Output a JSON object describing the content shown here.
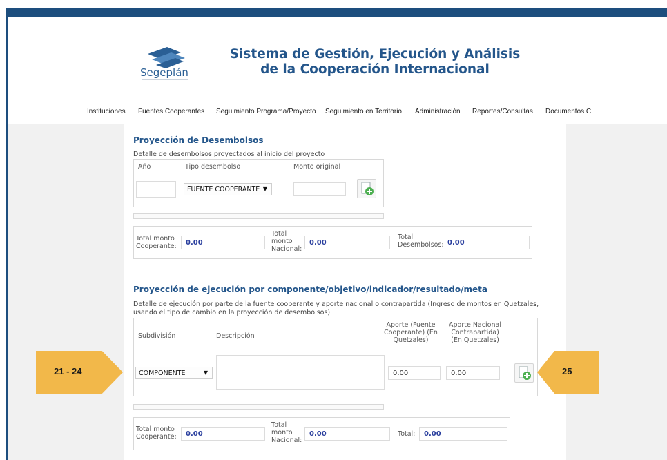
{
  "logo": {
    "text": "Segeplán",
    "icon": "segeplan-logo-icon"
  },
  "title": {
    "line1": "Sistema de Gestión, Ejecución y Análisis",
    "line2": "de la Cooperación Internacional"
  },
  "nav": {
    "items": [
      "Instituciones",
      "Fuentes Cooperantes",
      "Seguimiento Programa/Proyecto",
      "Seguimiento en Territorio",
      "Administración",
      "Reportes/Consultas",
      "Documentos CI"
    ]
  },
  "desembolsos": {
    "title": "Proyección de Desembolsos",
    "description": "Detalle de desembolsos proyectados al inicio del proyecto",
    "col_anio": "Año",
    "col_tipo": "Tipo desembolso",
    "col_monto": "Monto original",
    "anio_value": "",
    "tipo_value": "FUENTE COOPERANTE",
    "monto_value": "",
    "totals": {
      "cooperante_label": "Total monto Cooperante:",
      "cooperante_value": "0.00",
      "nacional_label": "Total monto Nacional:",
      "nacional_value": "0.00",
      "desembolsos_label": "Total Desembolsos:",
      "desembolsos_value": "0.00"
    }
  },
  "ejecucion": {
    "title": "Proyección de ejecución por componente/objetivo/indicador/resultado/meta",
    "description": "Detalle de ejecución por parte de la fuente cooperante y aporte nacional o contrapartida (Ingreso de montos en Quetzales, usando el tipo de cambio en la proyección de desembolsos)",
    "col_subdivision": "Subdivisión",
    "col_descripcion": "Descripción",
    "col_aporte_fuente": "Aporte (Fuente Cooperante) (En Quetzales)",
    "col_aporte_nacional": "Aporte Nacional Contrapartida) (En Quetzales)",
    "subdivision_value": "COMPONENTE",
    "aporte_fuente_value": "0.00",
    "aporte_nacional_value": "0.00",
    "totals": {
      "cooperante_label": "Total monto Cooperante:",
      "cooperante_value": "0.00",
      "nacional_label": "Total monto Nacional:",
      "nacional_value": "0.00",
      "total_label": "Total:",
      "total_value": "0.00"
    }
  },
  "callouts": {
    "left": "21 - 24",
    "right": "25"
  },
  "colors": {
    "frame": "#1d4e7e",
    "title": "#24568b",
    "value": "#2a3f9e",
    "callout": "#f2b84a"
  }
}
